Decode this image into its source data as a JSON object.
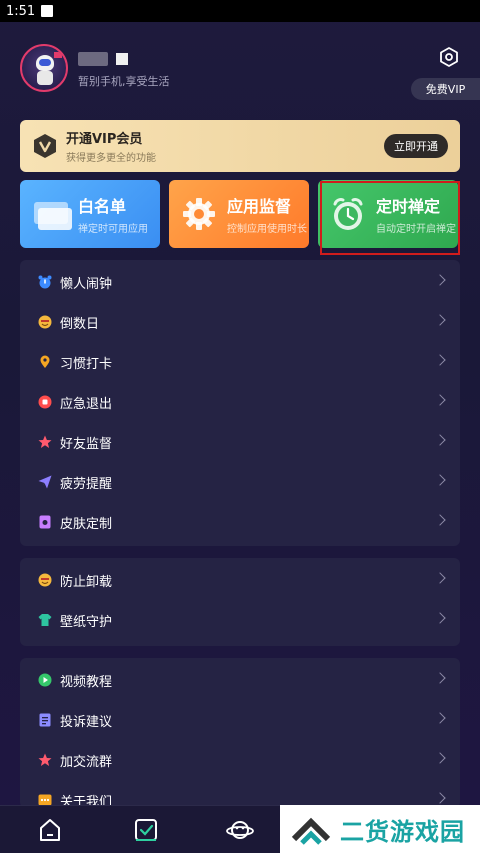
{
  "status_bar": {
    "time": "1:51"
  },
  "profile": {
    "slogan": "暂别手机,享受生活"
  },
  "header": {
    "vip_free_label": "免费VIP"
  },
  "vip_banner": {
    "title": "开通VIP会员",
    "subtitle": "获得更多更全的功能",
    "button": "立即开通"
  },
  "cards": [
    {
      "title": "白名单",
      "subtitle": "禅定时可用应用",
      "icon": "whitelist-icon",
      "color": "#3a8ef2"
    },
    {
      "title": "应用监督",
      "subtitle": "控制应用使用时长",
      "icon": "gear-icon",
      "color": "#ff7a2a"
    },
    {
      "title": "定时禅定",
      "subtitle": "自动定时开启禅定",
      "icon": "alarm-clock-icon",
      "color": "#2fa84f"
    }
  ],
  "menu_section_1": [
    {
      "label": "懒人闹钟",
      "icon": "alarm-icon",
      "color": "#3d8bff"
    },
    {
      "label": "倒数日",
      "icon": "smile-icon",
      "color": "#f5b83d"
    },
    {
      "label": "习惯打卡",
      "icon": "location-pin-icon",
      "color": "#f5a623"
    },
    {
      "label": "应急退出",
      "icon": "record-icon",
      "color": "#ff4d4d"
    },
    {
      "label": "好友监督",
      "icon": "star-icon",
      "color": "#ff5a6e"
    },
    {
      "label": "疲劳提醒",
      "icon": "paper-plane-icon",
      "color": "#8c7dff"
    },
    {
      "label": "皮肤定制",
      "icon": "skin-icon",
      "color": "#c77dff"
    }
  ],
  "menu_section_2": [
    {
      "label": "防止卸载",
      "icon": "smile-icon",
      "color": "#f5b83d"
    },
    {
      "label": "壁纸守护",
      "icon": "shirt-icon",
      "color": "#2ec4a0"
    }
  ],
  "menu_section_3": [
    {
      "label": "视频教程",
      "icon": "play-icon",
      "color": "#35c76b"
    },
    {
      "label": "投诉建议",
      "icon": "document-icon",
      "color": "#8c8cff"
    },
    {
      "label": "加交流群",
      "icon": "star-icon",
      "color": "#ff5a6e"
    },
    {
      "label": "关于我们",
      "icon": "more-icon",
      "color": "#f5a623"
    }
  ],
  "watermark": {
    "text": "二货游戏园"
  }
}
